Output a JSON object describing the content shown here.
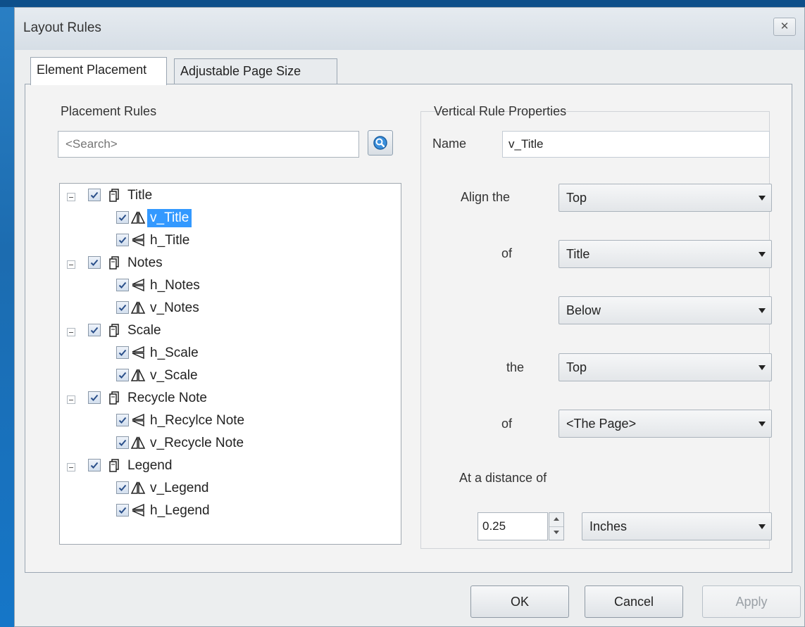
{
  "window": {
    "title": "Layout Rules",
    "close_glyph": "✕"
  },
  "tabs": [
    {
      "label": "Element Placement",
      "active": true
    },
    {
      "label": "Adjustable Page Size",
      "active": false
    }
  ],
  "placement_rules": {
    "heading": "Placement Rules",
    "search_placeholder": "<Search>",
    "tree": [
      {
        "label": "Title",
        "checked": true,
        "children": [
          {
            "label": "v_Title",
            "type": "vertical",
            "checked": true,
            "selected": true
          },
          {
            "label": "h_Title",
            "type": "horizontal",
            "checked": true
          }
        ]
      },
      {
        "label": "Notes",
        "checked": true,
        "children": [
          {
            "label": "h_Notes",
            "type": "horizontal",
            "checked": true
          },
          {
            "label": "v_Notes",
            "type": "vertical",
            "checked": true
          }
        ]
      },
      {
        "label": "Scale",
        "checked": true,
        "children": [
          {
            "label": "h_Scale",
            "type": "horizontal",
            "checked": true
          },
          {
            "label": "v_Scale",
            "type": "vertical",
            "checked": true
          }
        ]
      },
      {
        "label": "Recycle Note",
        "checked": true,
        "children": [
          {
            "label": "h_Recylce Note",
            "type": "horizontal",
            "checked": true
          },
          {
            "label": "v_Recycle Note",
            "type": "vertical",
            "checked": true
          }
        ]
      },
      {
        "label": "Legend",
        "checked": true,
        "children": [
          {
            "label": "v_Legend",
            "type": "vertical",
            "checked": true
          },
          {
            "label": "h_Legend",
            "type": "horizontal",
            "checked": true
          }
        ]
      }
    ]
  },
  "properties": {
    "heading": "Vertical Rule Properties",
    "name_label": "Name",
    "name_value": "v_Title",
    "align_label": "Align the",
    "align_value": "Top",
    "of_label_1": "of",
    "of_value_1": "Title",
    "relation_value": "Below",
    "the_label": "the",
    "the_value": "Top",
    "of_label_2": "of",
    "of_value_2": "<The Page>",
    "distance_label": "At a distance of",
    "distance_value": "0.25",
    "units_value": "Inches"
  },
  "buttons": {
    "ok": "OK",
    "cancel": "Cancel",
    "apply": "Apply"
  },
  "colors": {
    "selection": "#3399ff",
    "desktop": "#1a5f9e"
  }
}
